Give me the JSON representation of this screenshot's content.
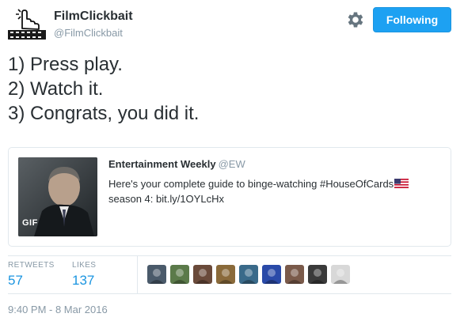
{
  "user": {
    "display_name": "FilmClickbait",
    "handle": "@FilmClickbait",
    "avatar_icon": "film-strip-hand-cursor-icon"
  },
  "actions": {
    "settings_icon": "gear-icon",
    "follow_label": "Following",
    "accent_color": "#1da1f2"
  },
  "tweet": {
    "lines": [
      "1) Press play.",
      "2) Watch it.",
      "3) Congrats, you did it."
    ]
  },
  "quote": {
    "author_name": "Entertainment Weekly",
    "author_handle": "@EW",
    "text_line1": "Here's your complete guide to binge-watching #HouseOfCards",
    "text_line2": "season 4: bit.ly/1OYLcHx",
    "media_badge": "GIF",
    "flag_icon": "us-flag-emoji"
  },
  "stats": {
    "retweets_label": "RETWEETS",
    "retweets_count": "57",
    "likes_label": "LIKES",
    "likes_count": "137"
  },
  "likers": [
    {
      "color": "#4a5a6a"
    },
    {
      "color": "#5b7a4a"
    },
    {
      "color": "#6a4a3a"
    },
    {
      "color": "#8a6a3a"
    },
    {
      "color": "#3a6a8a"
    },
    {
      "color": "#2a4aa8"
    },
    {
      "color": "#7a5a4a"
    },
    {
      "color": "#3a3a3a"
    },
    {
      "color": "#d8d8d8"
    }
  ],
  "timestamp": "9:40 PM - 8 Mar 2016"
}
